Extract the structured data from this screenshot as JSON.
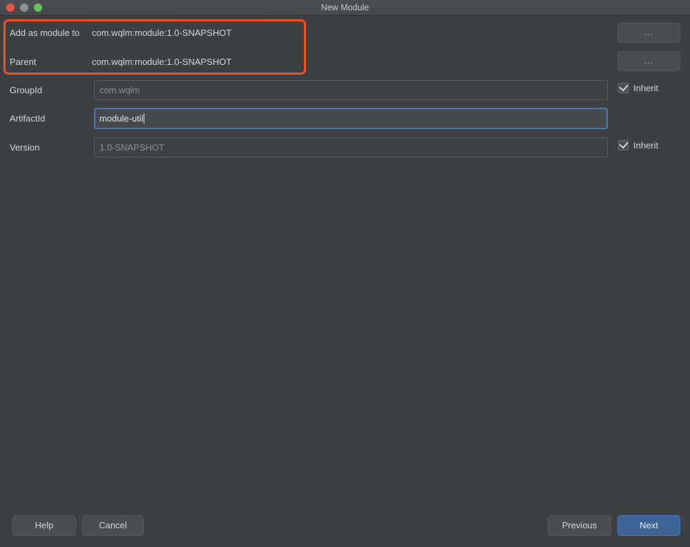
{
  "window": {
    "title": "New Module",
    "traffic_lights": [
      {
        "name": "close-button",
        "color": "#e8564a"
      },
      {
        "name": "minimize-button",
        "color": "#8e9192"
      },
      {
        "name": "maximize-button",
        "color": "#62c454"
      }
    ]
  },
  "annotation": {
    "highlight_color": "#f4511e"
  },
  "info_rows": [
    {
      "label": "Add as module to",
      "value": "com.wqlm:module:1.0-SNAPSHOT",
      "browse_label": "..."
    },
    {
      "label": "Parent",
      "value": "com.wqlm:module:1.0-SNAPSHOT",
      "browse_label": "..."
    }
  ],
  "form": {
    "group_id": {
      "label": "GroupId",
      "value": "",
      "placeholder": "com.wqlm",
      "focused": false,
      "inherit_label": "Inherit",
      "inherit_checked": true
    },
    "artifact_id": {
      "label": "ArtifactId",
      "value": "module-util",
      "placeholder": "",
      "focused": true,
      "inherit_label": "",
      "inherit_checked": false
    },
    "version": {
      "label": "Version",
      "value": "",
      "placeholder": "1.0-SNAPSHOT",
      "focused": false,
      "inherit_label": "Inherit",
      "inherit_checked": true
    }
  },
  "footer": {
    "help_label": "Help",
    "cancel_label": "Cancel",
    "previous_label": "Previous",
    "next_label": "Next",
    "next_accent_color": "#3c6494"
  }
}
